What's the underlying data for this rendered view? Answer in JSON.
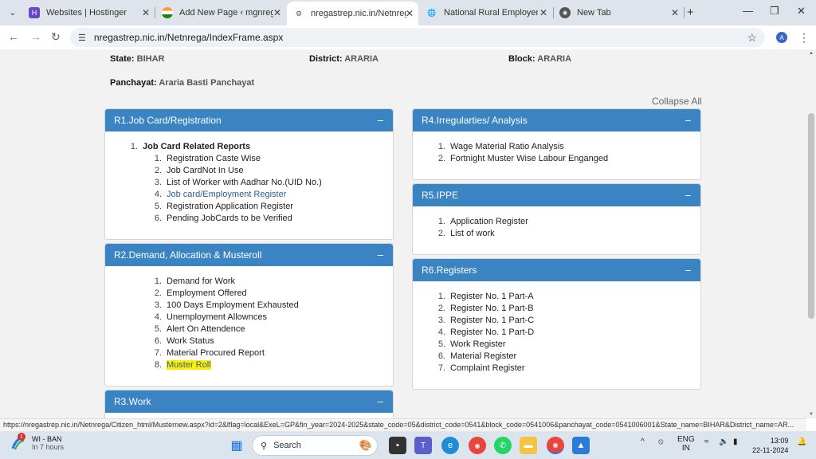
{
  "tabs": [
    {
      "label": "Websites | Hostinger",
      "icon": "hostinger-icon"
    },
    {
      "label": "Add New Page ‹ mgnregajob",
      "icon": "india-flag-icon"
    },
    {
      "label": "nregastrep.nic.in/Netnrega/I",
      "icon": "site-icon",
      "active": true
    },
    {
      "label": "National Rural Employement",
      "icon": "globe-icon"
    },
    {
      "label": "New Tab",
      "icon": "chrome-icon"
    }
  ],
  "address": {
    "url": "nregastrep.nic.in/Netnrega/IndexFrame.aspx"
  },
  "profile_initial": "A",
  "info": {
    "state_label": "State:",
    "state_value": "BIHAR",
    "district_label": "District:",
    "district_value": "ARARIA",
    "block_label": "Block:",
    "block_value": "ARARIA",
    "panchayat_label": "Panchayat:",
    "panchayat_value": "Araria Basti Panchayat"
  },
  "collapse_all": "Collapse All",
  "panels": {
    "r1": {
      "title": "R1.Job Card/Registration",
      "group_num": "1.",
      "group_title": "Job Card Related Reports",
      "items": [
        {
          "num": "1.",
          "label": "Registration Caste Wise"
        },
        {
          "num": "2.",
          "label": "Job CardNot In Use"
        },
        {
          "num": "3.",
          "label": "List of Worker with Aadhar No.(UID No.)"
        },
        {
          "num": "4.",
          "label": "Job card/Employment Register"
        },
        {
          "num": "5.",
          "label": "Registration Application Register"
        },
        {
          "num": "6.",
          "label": "Pending JobCards to be Verified"
        }
      ]
    },
    "r2": {
      "title": "R2.Demand, Allocation & Musteroll",
      "items": [
        {
          "num": "1.",
          "label": "Demand for Work"
        },
        {
          "num": "2.",
          "label": "Employment Offered"
        },
        {
          "num": "3.",
          "label": "100 Days Employment Exhausted"
        },
        {
          "num": "4.",
          "label": "Unemployment Allownces"
        },
        {
          "num": "5.",
          "label": "Alert On Attendence"
        },
        {
          "num": "6.",
          "label": "Work Status"
        },
        {
          "num": "7.",
          "label": "Material Procured Report"
        },
        {
          "num": "8.",
          "label": "Muster Roll"
        }
      ]
    },
    "r3": {
      "title": "R3.Work"
    },
    "r4": {
      "title": "R4.Irregularties/ Analysis",
      "items": [
        {
          "num": "1.",
          "label": "Wage Material Ratio Analysis"
        },
        {
          "num": "2.",
          "label": "Fortnight Muster Wise Labour Enganged"
        }
      ]
    },
    "r5": {
      "title": "R5.IPPE",
      "items": [
        {
          "num": "1.",
          "label": "Application Register"
        },
        {
          "num": "2.",
          "label": "List of work"
        }
      ]
    },
    "r6": {
      "title": "R6.Registers",
      "items": [
        {
          "num": "1.",
          "label": "Register No. 1 Part-A"
        },
        {
          "num": "2.",
          "label": "Register No. 1 Part-B"
        },
        {
          "num": "3.",
          "label": "Register No. 1 Part-C"
        },
        {
          "num": "4.",
          "label": "Register No. 1 Part-D"
        },
        {
          "num": "5.",
          "label": "Work Register"
        },
        {
          "num": "6.",
          "label": "Material Register"
        },
        {
          "num": "7.",
          "label": "Complaint Register"
        }
      ]
    }
  },
  "status_url": "https://nregastrep.nic.in/Netnrega/Citizen_html/Musternew.aspx?id=2&lflag=local&ExeL=GP&fin_year=2024-2025&state_code=05&district_code=0541&block_code=0541006&panchayat_code=0541006001&State_name=BIHAR&District_name=AR...",
  "taskbar": {
    "weather_title": "WI - BAN",
    "weather_sub": "In 7 hours",
    "weather_badge": "1",
    "search_placeholder": "Search",
    "lang1": "ENG",
    "lang2": "IN",
    "time": "13:09",
    "date": "22-11-2024"
  }
}
